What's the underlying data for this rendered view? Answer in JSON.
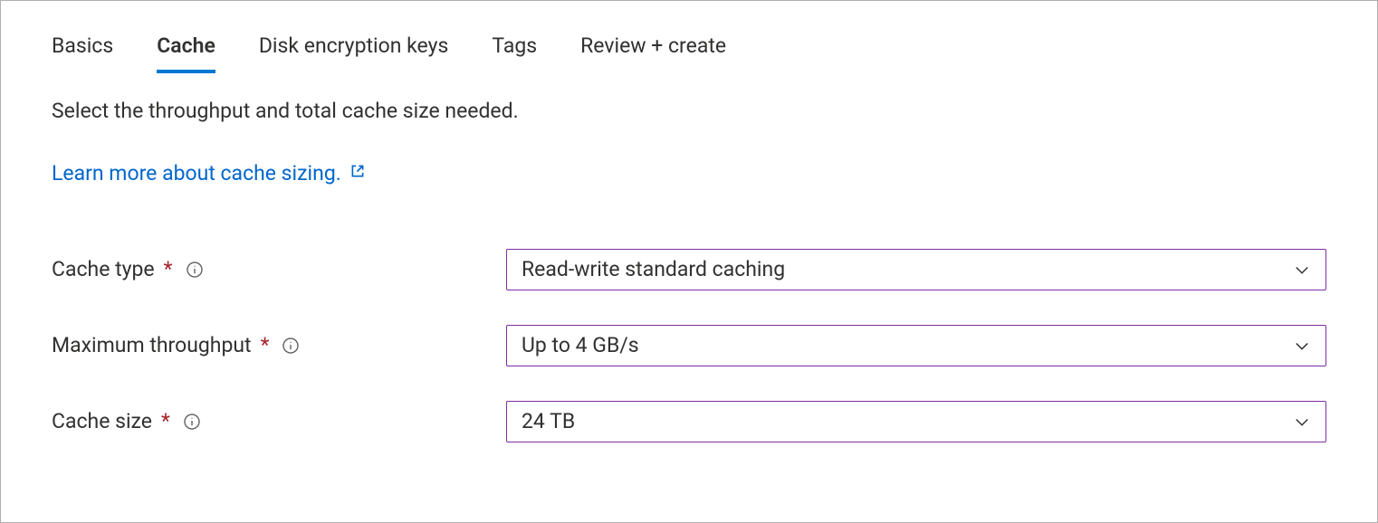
{
  "tabs": {
    "basics": "Basics",
    "cache": "Cache",
    "diskEncryption": "Disk encryption keys",
    "tags": "Tags",
    "reviewCreate": "Review + create",
    "active": "cache"
  },
  "description": "Select the throughput and total cache size needed.",
  "learnMore": "Learn more about cache sizing.",
  "fields": {
    "cacheType": {
      "label": "Cache type",
      "value": "Read-write standard caching"
    },
    "maxThroughput": {
      "label": "Maximum throughput",
      "value": "Up to 4 GB/s"
    },
    "cacheSize": {
      "label": "Cache size",
      "value": "24 TB"
    }
  },
  "colors": {
    "link": "#0066cc",
    "tabUnderline": "#0078d4",
    "selectBorder": "#7b2fa0",
    "required": "#a4262c"
  }
}
